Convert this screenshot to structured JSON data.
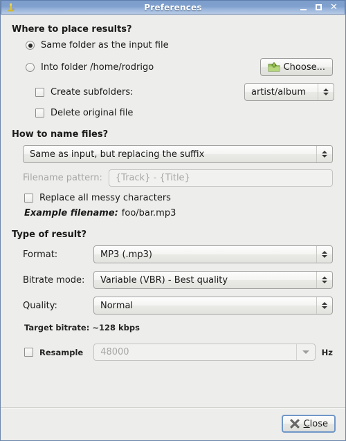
{
  "window": {
    "title": "Preferences",
    "icon": "app-icon",
    "controls": {
      "minimize": "–",
      "maximize": "□",
      "close": "✕"
    }
  },
  "colors": {
    "titlebar_start": "#7e9dcb",
    "titlebar_end": "#b7cbe6",
    "dialog_bg": "#ededeb",
    "border": "#6c86ab",
    "focus_blue": "#6f97c8",
    "disabled_text": "#a6a6a4",
    "folder_green": "#8cb84a"
  },
  "where_section": {
    "title": "Where to place results?",
    "radio_same_folder": {
      "label": "Same folder as the input file",
      "selected": true
    },
    "radio_into_folder": {
      "label": "Into folder /home/rodrigo",
      "selected": false
    },
    "choose_button": {
      "label": "Choose...",
      "icon": "folder-upload-icon"
    },
    "create_subfolders": {
      "label": "Create subfolders:",
      "checked": false
    },
    "subfolder_pattern": {
      "value": "artist/album"
    },
    "delete_original": {
      "label": "Delete original file",
      "checked": false
    }
  },
  "naming_section": {
    "title": "How to name files?",
    "naming_mode": {
      "value": "Same as input, but replacing the suffix"
    },
    "filename_pattern": {
      "label": "Filename pattern:",
      "placeholder": "{Track} - {Title}",
      "disabled": true
    },
    "replace_messy": {
      "label": "Replace all messy characters",
      "checked": false
    },
    "example": {
      "prefix": "Example filename:",
      "value": "foo/bar.mp3"
    }
  },
  "result_section": {
    "title": "Type of result?",
    "format": {
      "label": "Format:",
      "value": "MP3 (.mp3)"
    },
    "bitrate_mode": {
      "label": "Bitrate mode:",
      "value": "Variable (VBR) - Best quality"
    },
    "quality": {
      "label": "Quality:",
      "value": "Normal"
    },
    "target_bitrate": "Target bitrate: ~128 kbps",
    "resample": {
      "label": "Resample",
      "checked": false,
      "value": "48000",
      "unit": "Hz",
      "disabled": true
    }
  },
  "footer": {
    "close_button": {
      "label_mnemonic": "C",
      "label_rest": "lose",
      "icon": "close-x-icon"
    }
  }
}
